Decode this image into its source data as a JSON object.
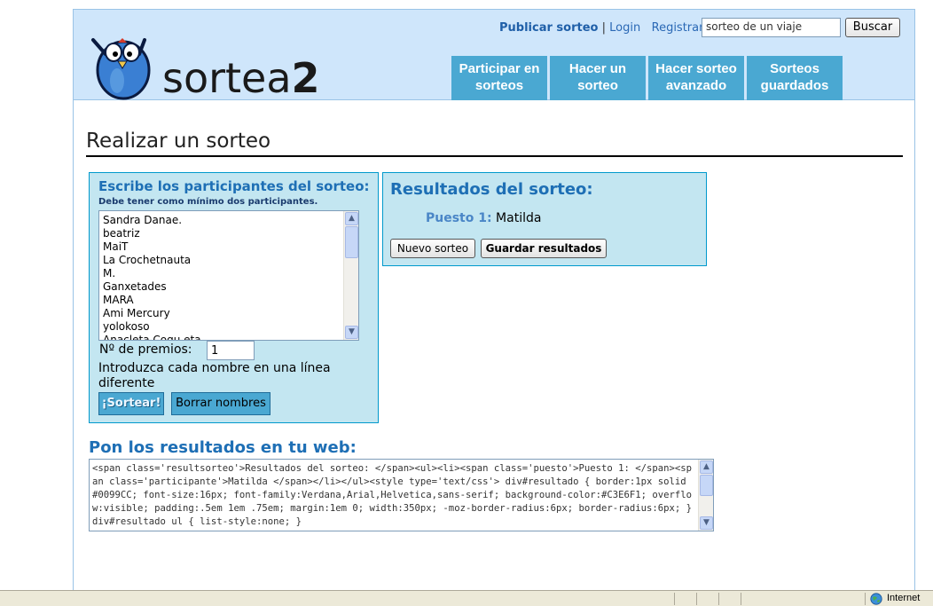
{
  "header": {
    "logo_text_light": "sortea",
    "logo_text_bold": "2",
    "links": {
      "publish": "Publicar sorteo",
      "separator": "|",
      "login": "Login",
      "register": "Registrar"
    },
    "search": {
      "value": "sorteo de un viaje",
      "button": "Buscar"
    },
    "nav": [
      {
        "line1": "Participar en",
        "line2": "sorteos"
      },
      {
        "line1": "Hacer un",
        "line2": "sorteo"
      },
      {
        "line1": "Hacer sorteo",
        "line2": "avanzado"
      },
      {
        "line1": "Sorteos",
        "line2": "guardados"
      }
    ]
  },
  "main": {
    "title": "Realizar un sorteo",
    "participants": {
      "heading": "Escribe los participantes del sorteo:",
      "subheading": "Debe tener como mínimo dos participantes.",
      "names": [
        "Sandra Danae.",
        "beatriz",
        "MaiT",
        "La Crochetnauta",
        "M.",
        "Ganxetades",
        "MARA",
        "Ami Mercury",
        "yolokoso",
        "Anacleta Coqu eta"
      ],
      "prizes_label": "Nº de premios:",
      "prizes_value": "1",
      "hint": "Introduzca cada nombre en una línea diferente",
      "draw_button": "¡Sortear!",
      "clear_button": "Borrar nombres"
    },
    "results": {
      "heading": "Resultados del sorteo:",
      "position_label": "Puesto 1:",
      "winner": "Matilda",
      "new_button": "Nuevo sorteo",
      "save_button": "Guardar resultados"
    },
    "embed": {
      "heading": "Pon los resultados en tu web:",
      "code": "<span class='resultsorteo'>Resultados del sorteo: </span><ul><li><span class='puesto'>Puesto 1: </span><span class='participante'>Matilda </span></li></ul><style type='text/css'> div#resultado { border:1px solid #0099CC; font-size:16px; font-family:Verdana,Arial,Helvetica,sans-serif; background-color:#C3E6F1; overflow:visible; padding:.5em 1em .75em; margin:1em 0; width:350px; -moz-border-radius:6px; border-radius:6px; } div#resultado ul { list-style:none; }"
    }
  },
  "statusbar": {
    "zone": "Internet"
  },
  "colors": {
    "header_bg": "#cfe6fb",
    "nav_bg": "#4aa8d2",
    "panel_bg": "#c3e6f1",
    "panel_border": "#0099cc",
    "heading_blue": "#1e6fb5"
  }
}
